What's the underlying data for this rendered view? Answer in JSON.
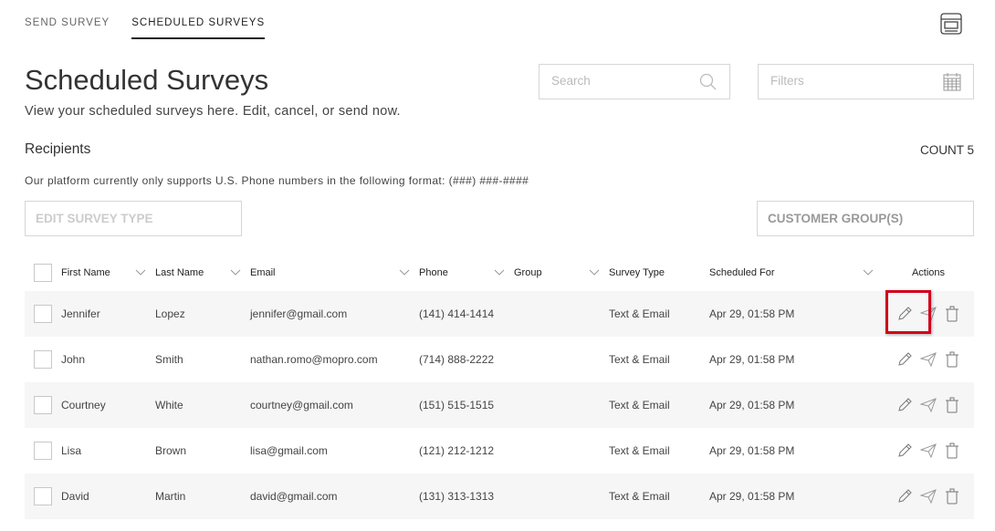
{
  "tabs": [
    {
      "label": "SEND SURVEY",
      "active": false
    },
    {
      "label": "SCHEDULED SURVEYS",
      "active": true
    }
  ],
  "page": {
    "title": "Scheduled Surveys",
    "subtitle": "View your scheduled surveys here. Edit, cancel, or send now."
  },
  "search": {
    "placeholder": "Search"
  },
  "filters": {
    "placeholder": "Filters"
  },
  "recipients": {
    "label": "Recipients",
    "count_label": "COUNT 5",
    "note": "Our platform currently only supports U.S. Phone numbers in the following format: (###) ###-####",
    "edit_survey_type": "EDIT SURVEY TYPE",
    "customer_groups": "CUSTOMER GROUP(S)"
  },
  "table": {
    "headers": {
      "first_name": "First Name",
      "last_name": "Last Name",
      "email": "Email",
      "phone": "Phone",
      "group": "Group",
      "survey_type": "Survey Type",
      "scheduled_for": "Scheduled For",
      "actions": "Actions"
    },
    "rows": [
      {
        "first": "Jennifer",
        "last": "Lopez",
        "email": "jennifer@gmail.com",
        "phone": "(141) 414-1414",
        "group": "",
        "type": "Text & Email",
        "scheduled": "Apr 29, 01:58 PM"
      },
      {
        "first": "John",
        "last": "Smith",
        "email": "nathan.romo@mopro.com",
        "phone": "(714) 888-2222",
        "group": "",
        "type": "Text & Email",
        "scheduled": "Apr 29, 01:58 PM"
      },
      {
        "first": "Courtney",
        "last": "White",
        "email": "courtney@gmail.com",
        "phone": "(151) 515-1515",
        "group": "",
        "type": "Text & Email",
        "scheduled": "Apr 29, 01:58 PM"
      },
      {
        "first": "Lisa",
        "last": "Brown",
        "email": "lisa@gmail.com",
        "phone": "(121) 212-1212",
        "group": "",
        "type": "Text & Email",
        "scheduled": "Apr 29, 01:58 PM"
      },
      {
        "first": "David",
        "last": "Martin",
        "email": "david@gmail.com",
        "phone": "(131) 313-1313",
        "group": "",
        "type": "Text & Email",
        "scheduled": "Apr 29, 01:58 PM"
      }
    ]
  },
  "colors": {
    "highlight": "#d0021b",
    "row_alt": "#f6f6f6",
    "border": "#d6d6d6"
  }
}
